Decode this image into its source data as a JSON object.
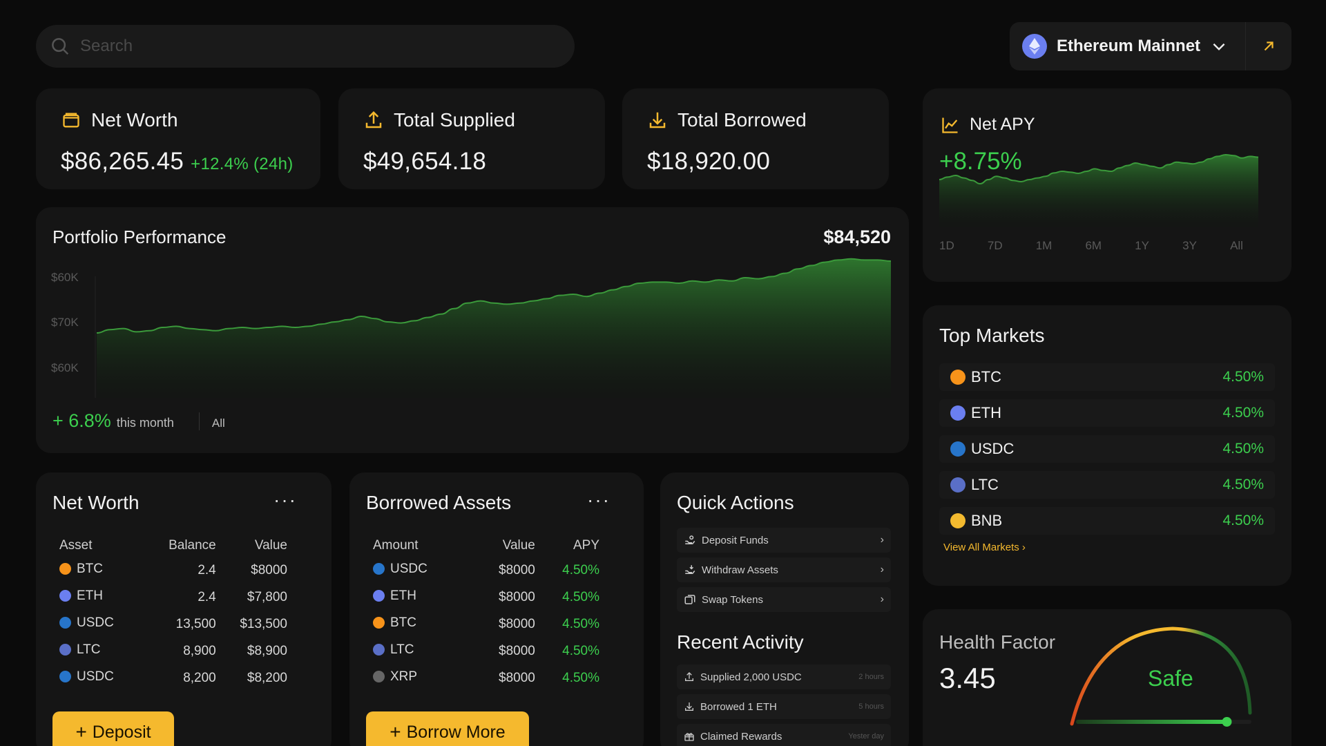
{
  "search": {
    "placeholder": "Search"
  },
  "network": {
    "label": "Ethereum Mainnet",
    "icon": "ethereum-icon"
  },
  "stats": {
    "net_worth": {
      "title": "Net Worth",
      "value": "$86,265.45",
      "change": "+12.4% (24h)"
    },
    "total_supplied": {
      "title": "Total Supplied",
      "value": "$49,654.18"
    },
    "total_borrowed": {
      "title": "Total Borrowed",
      "value": "$18,920.00"
    }
  },
  "portfolio": {
    "title": "Portfolio Performance",
    "value": "$84,520",
    "change": "+ 6.8%",
    "period": "this month",
    "filter": "All",
    "y_ticks": [
      "$60K",
      "$70K",
      "$60K"
    ],
    "series": [
      0.3,
      0.33,
      0.34,
      0.31,
      0.32,
      0.35,
      0.36,
      0.34,
      0.33,
      0.32,
      0.34,
      0.35,
      0.34,
      0.35,
      0.36,
      0.35,
      0.36,
      0.38,
      0.4,
      0.42,
      0.45,
      0.43,
      0.4,
      0.39,
      0.41,
      0.44,
      0.47,
      0.52,
      0.57,
      0.59,
      0.57,
      0.56,
      0.57,
      0.59,
      0.61,
      0.64,
      0.65,
      0.63,
      0.66,
      0.69,
      0.72,
      0.75,
      0.76,
      0.76,
      0.75,
      0.77,
      0.76,
      0.78,
      0.77,
      0.8,
      0.79,
      0.81,
      0.84,
      0.88,
      0.91,
      0.94,
      0.96,
      0.97,
      0.96,
      0.96,
      0.95
    ]
  },
  "net_worth_table": {
    "title": "Net Worth",
    "more": "···",
    "headers": [
      "Asset",
      "Balance",
      "Value"
    ],
    "rows": [
      {
        "asset": "BTC",
        "balance": "2.4",
        "value": "$8000",
        "color": "#f7931a"
      },
      {
        "asset": "ETH",
        "balance": "2.4",
        "value": "$7,800",
        "color": "#6b7ff0"
      },
      {
        "asset": "USDC",
        "balance": "13,500",
        "value": "$13,500",
        "color": "#2775ca"
      },
      {
        "asset": "LTC",
        "balance": "8,900",
        "value": "$8,900",
        "color": "#5a6fc7"
      },
      {
        "asset": "USDC",
        "balance": "8,200",
        "value": "$8,200",
        "color": "#2775ca"
      }
    ],
    "button": "Deposit"
  },
  "borrowed_table": {
    "title": "Borrowed Assets",
    "more": "···",
    "headers": [
      "Amount",
      "Value",
      "APY"
    ],
    "rows": [
      {
        "asset": "USDC",
        "value": "$8000",
        "apy": "4.50%",
        "color": "#2775ca"
      },
      {
        "asset": "ETH",
        "value": "$8000",
        "apy": "4.50%",
        "color": "#6b7ff0"
      },
      {
        "asset": "BTC",
        "value": "$8000",
        "apy": "4.50%",
        "color": "#f7931a"
      },
      {
        "asset": "LTC",
        "value": "$8000",
        "apy": "4.50%",
        "color": "#5a6fc7"
      },
      {
        "asset": "XRP",
        "value": "$8000",
        "apy": "4.50%",
        "color": "#666666"
      }
    ],
    "button": "Borrow More"
  },
  "quick_actions": {
    "title": "Quick Actions",
    "items": [
      {
        "label": "Deposit Funds",
        "icon": "deposit-icon"
      },
      {
        "label": "Withdraw Assets",
        "icon": "withdraw-icon"
      },
      {
        "label": "Swap Tokens",
        "icon": "swap-icon"
      }
    ]
  },
  "recent_activity": {
    "title": "Recent Activity",
    "items": [
      {
        "label": "Supplied 2,000 USDC",
        "time": "2 hours",
        "icon": "upload-icon"
      },
      {
        "label": "Borrowed 1 ETH",
        "time": "5 hours",
        "icon": "download-icon"
      },
      {
        "label": "Claimed Rewards",
        "time": "Yester day",
        "icon": "gift-icon"
      }
    ]
  },
  "net_apy": {
    "title": "Net APY",
    "value": "+8.75%",
    "tabs": [
      "1D",
      "7D",
      "1M",
      "6M",
      "1Y",
      "3Y",
      "All"
    ],
    "series": [
      0.3,
      0.36,
      0.4,
      0.34,
      0.28,
      0.2,
      0.3,
      0.38,
      0.34,
      0.28,
      0.25,
      0.3,
      0.34,
      0.38,
      0.46,
      0.5,
      0.48,
      0.45,
      0.5,
      0.56,
      0.52,
      0.5,
      0.58,
      0.64,
      0.7,
      0.66,
      0.62,
      0.58,
      0.66,
      0.72,
      0.7,
      0.68,
      0.72,
      0.8,
      0.86,
      0.9,
      0.88,
      0.82,
      0.86,
      0.84
    ]
  },
  "top_markets": {
    "title": "Top Markets",
    "items": [
      {
        "asset": "BTC",
        "rate": "4.50%",
        "color": "#f7931a"
      },
      {
        "asset": "ETH",
        "rate": "4.50%",
        "color": "#6b7ff0"
      },
      {
        "asset": "USDC",
        "rate": "4.50%",
        "color": "#2775ca"
      },
      {
        "asset": "LTC",
        "rate": "4.50%",
        "color": "#5a6fc7"
      },
      {
        "asset": "BNB",
        "rate": "4.50%",
        "color": "#f3ba2f"
      }
    ],
    "link": "View All Markets ›"
  },
  "health": {
    "title": "Health Factor",
    "value": "3.45",
    "status": "Safe",
    "level": 0.86
  },
  "colors": {
    "accent": "#f5b92e",
    "positive": "#3ccf4e",
    "card": "#151515",
    "background": "#0b0b0b"
  }
}
